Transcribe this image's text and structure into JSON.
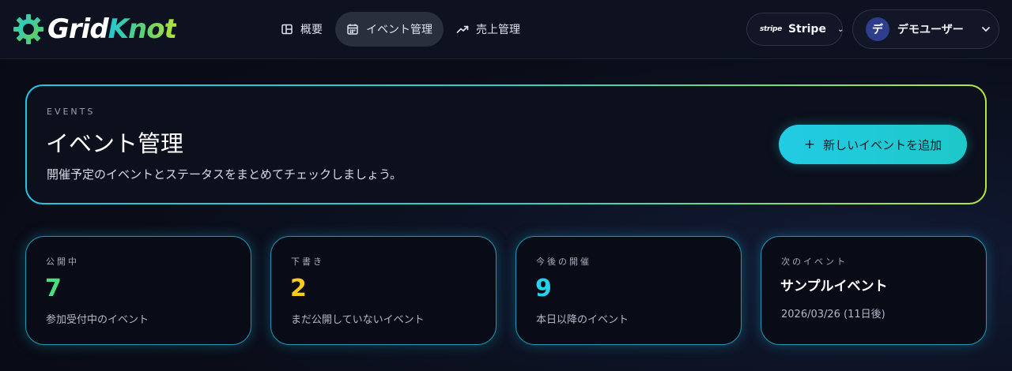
{
  "brand": {
    "part1": "Grid",
    "part2": "Knot"
  },
  "nav": {
    "items": [
      {
        "label": "概要",
        "icon": "layout-icon"
      },
      {
        "label": "イベント管理",
        "icon": "calendar-icon",
        "active": true
      },
      {
        "label": "売上管理",
        "icon": "trending-up-icon"
      }
    ]
  },
  "stripe": {
    "logo": "stripe",
    "label": "Stripe"
  },
  "user": {
    "avatar": "デ",
    "name": "デモユーザー"
  },
  "hero": {
    "eyebrow": "EVENTS",
    "title": "イベント管理",
    "description": "開催予定のイベントとステータスをまとめてチェックしましょう。",
    "add_button": "新しいイベントを追加"
  },
  "stats": [
    {
      "label": "公開中",
      "value": "7",
      "sub": "参加受付中のイベント",
      "color": "#4ade80"
    },
    {
      "label": "下書き",
      "value": "2",
      "sub": "まだ公開していないイベント",
      "color": "#facc15"
    },
    {
      "label": "今後の開催",
      "value": "9",
      "sub": "本日以降のイベント",
      "color": "#22d3ee"
    }
  ],
  "next_event": {
    "label": "次のイベント",
    "title": "サンプルイベント",
    "date": "2026/03/26 (11日後)"
  }
}
